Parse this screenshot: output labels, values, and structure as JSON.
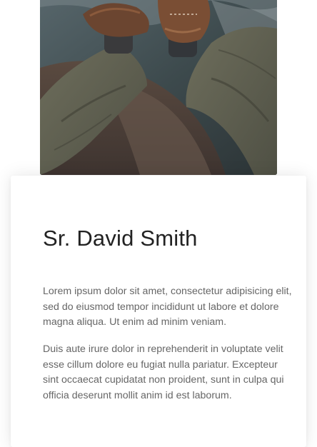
{
  "profile": {
    "photo_alt": "feet-on-rock-photo",
    "name": "Sr. David Smith",
    "paragraphs": [
      "Lorem ipsum dolor sit amet, consectetur adipisicing elit, sed do eiusmod tempor incididunt ut labore et dolore magna aliqua. Ut enim ad minim veniam.",
      "Duis aute irure dolor in reprehenderit in voluptate velit esse cillum dolore eu fugiat nulla pariatur. Excepteur sint occaecat cupidatat non proident, sunt in culpa qui officia deserunt mollit anim id est laborum."
    ]
  },
  "colors": {
    "heading": "#222222",
    "body_text": "#666666",
    "card_background": "#ffffff"
  }
}
